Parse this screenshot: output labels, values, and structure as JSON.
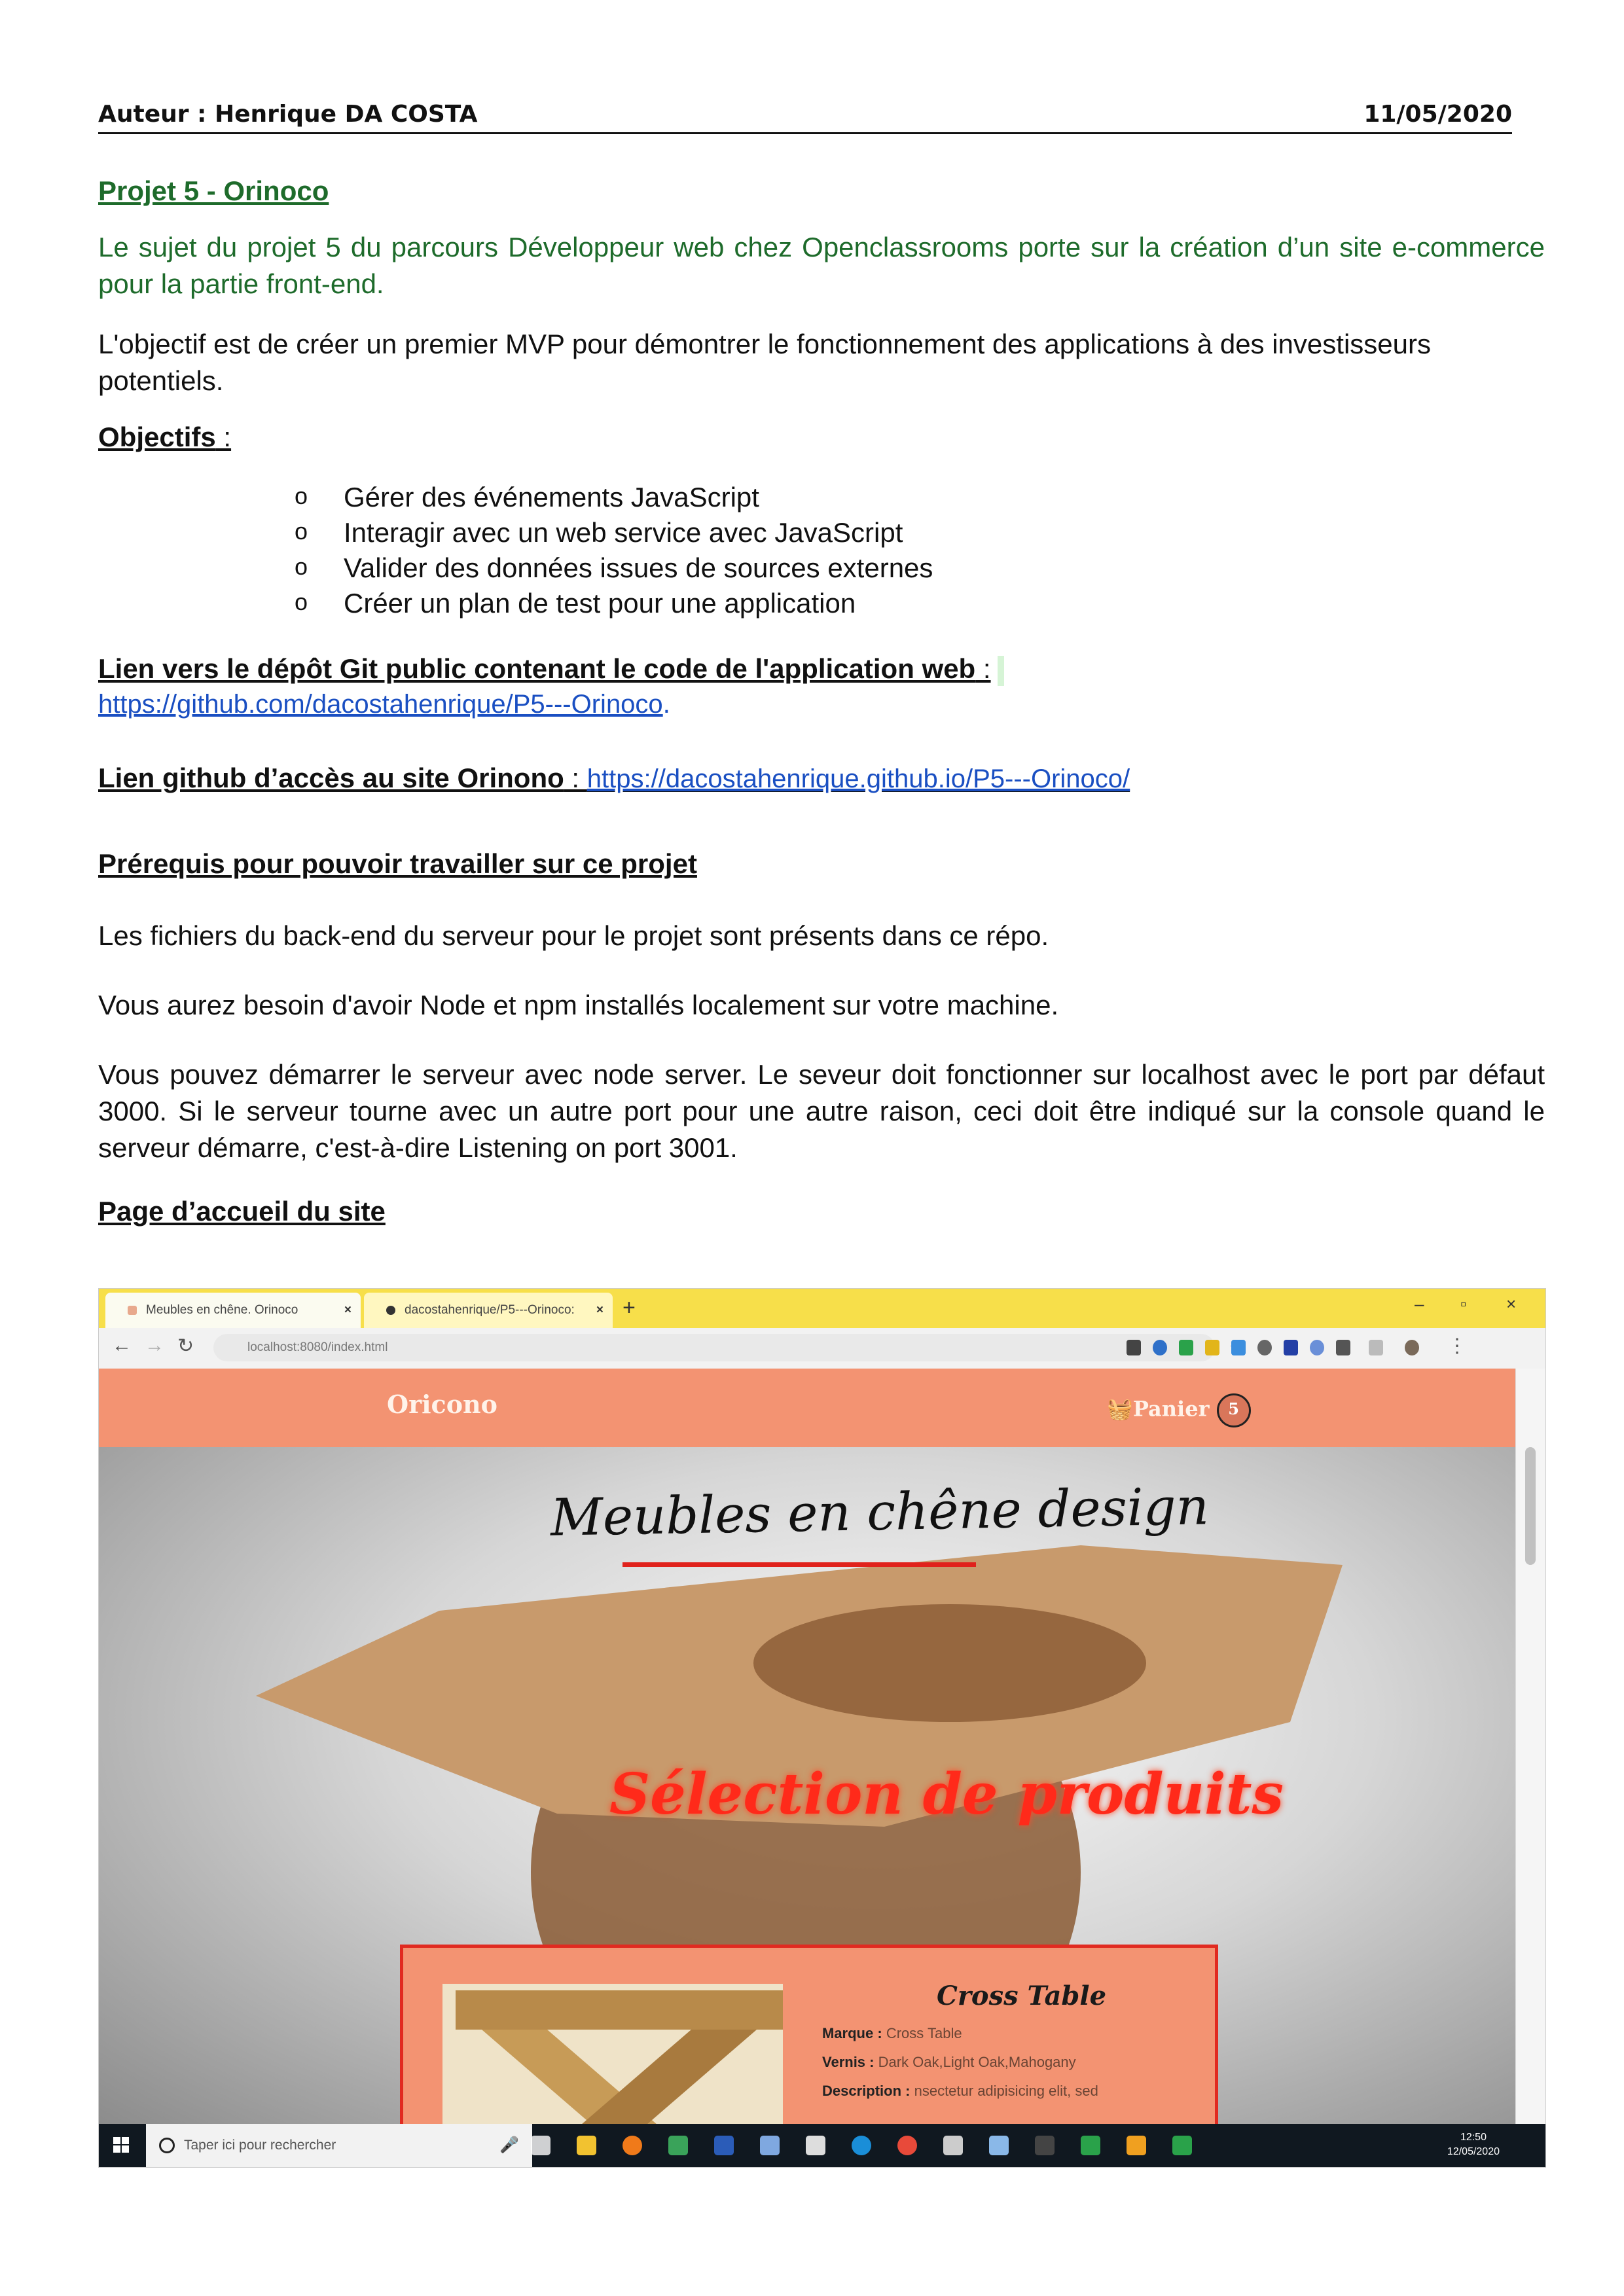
{
  "header": {
    "author": "Auteur : Henrique DA COSTA",
    "date": "11/05/2020"
  },
  "project_title": "Projet 5 - Orinoco",
  "intro": "Le sujet du projet 5 du parcours Développeur web chez Openclassrooms porte sur la création d’un site e-commerce pour la partie front-end.",
  "objective_text": "L'objectif est de créer un premier MVP pour démontrer le fonctionnement des applications à des investisseurs potentiels.",
  "objectives": {
    "heading": "Objectifs",
    "suffix": " :",
    "items": [
      "Gérer des événements JavaScript",
      "Interagir avec un web service avec JavaScript",
      "Valider des données issues de sources externes",
      "Créer un plan de test pour une application"
    ]
  },
  "repo": {
    "heading": "Lien vers le dépôt Git public contenant le code de l'application web",
    "sep": " :",
    "url": "https://github.com/dacostahenrique/P5---Orinoco",
    "end": "."
  },
  "site_link": {
    "heading": "Lien github d’accès au site Orinono",
    "sep": " : ",
    "url": "https://dacostahenrique.github.io/P5---Orinoco/"
  },
  "prereq": {
    "heading": "Prérequis pour pouvoir travailler sur ce projet",
    "p1": "Les fichiers du back-end du serveur pour le projet sont présents dans ce répo.",
    "p2": "Vous aurez besoin d'avoir Node et npm installés localement sur votre machine.",
    "p3": "Vous pouvez démarrer le serveur avec node server. Le seveur doit fonctionner sur localhost avec le port par défaut 3000. Si le serveur tourne avec un autre port pour une autre raison, ceci doit être indiqué sur la console quand le serveur démarre, c'est-à-dire Listening on port 3001."
  },
  "home_heading": "Page d’accueil du site",
  "screenshot": {
    "tab1": "Meubles en chêne. Orinoco",
    "tab2": "dacostahenrique/P5---Orinoco: ",
    "tab_close": "×",
    "new_tab": "+",
    "url": "localhost:8080/index.html",
    "brand": "Oricono",
    "cart_label": "Panier",
    "cart_count": "5",
    "hero_title": "Meubles en chêne design",
    "hero_subtitle": "Sélection de produits",
    "product": {
      "name": "Cross Table",
      "brand_label": "Marque :",
      "brand_value": "Cross Table",
      "varnish_label": "Vernis :",
      "varnish_value": "Dark Oak,Light Oak,Mahogany",
      "desc_label": "Description :",
      "desc_value": "nsectetur adipisicing elit, sed"
    },
    "taskbar_search": "Taper ici pour rechercher",
    "time": "12:50",
    "date": "12/05/2020",
    "accent_colors": {
      "nav": "#f39372",
      "tab_bar": "#f7df4a",
      "hero_red": "#ff2a1a"
    }
  }
}
